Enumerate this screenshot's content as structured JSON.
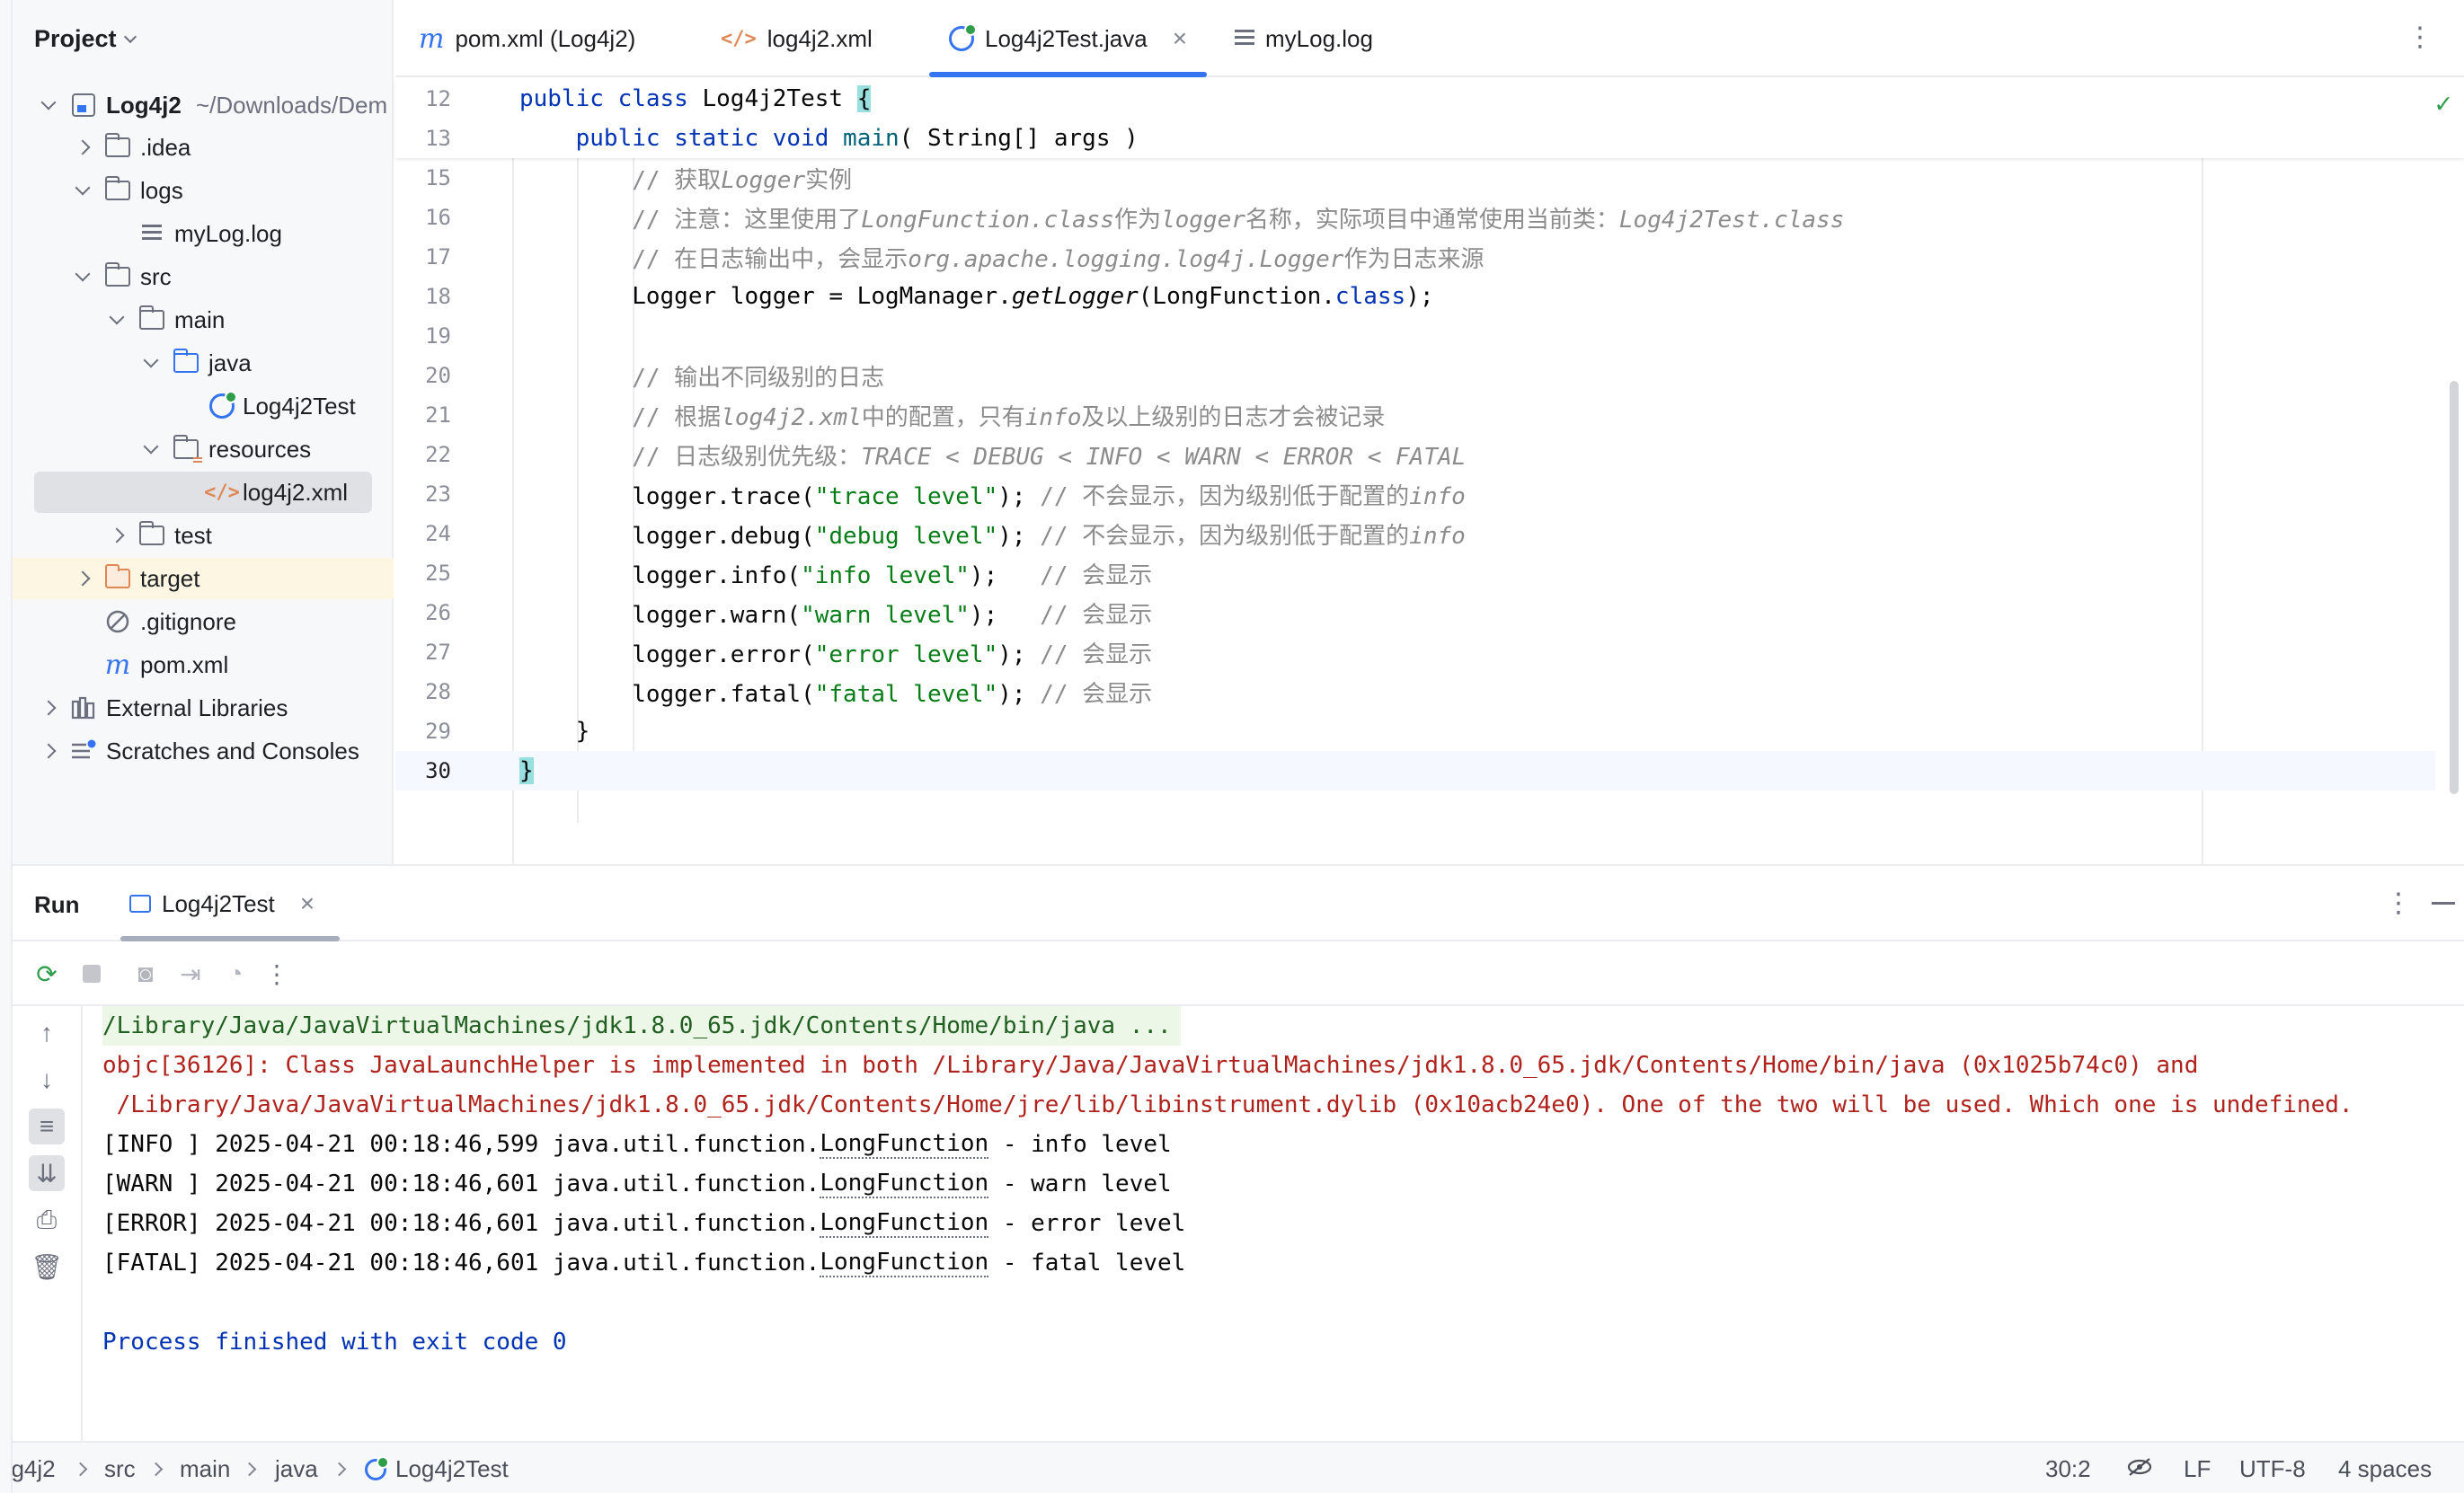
{
  "project_panel": {
    "title": "Project",
    "tree": [
      {
        "label": "Log4j2",
        "hint": "~/Downloads/Dem",
        "icon": "project-module-icon",
        "expanded": true
      },
      {
        "label": ".idea",
        "icon": "folder-icon"
      },
      {
        "label": "logs",
        "icon": "folder-icon",
        "expanded": true
      },
      {
        "label": "myLog.log",
        "icon": "log-file-icon"
      },
      {
        "label": "src",
        "icon": "folder-icon",
        "expanded": true
      },
      {
        "label": "main",
        "icon": "folder-icon",
        "expanded": true
      },
      {
        "label": "java",
        "icon": "source-folder-icon",
        "expanded": true
      },
      {
        "label": "Log4j2Test",
        "icon": "java-class-icon"
      },
      {
        "label": "resources",
        "icon": "resources-folder-icon",
        "expanded": true
      },
      {
        "label": "log4j2.xml",
        "icon": "xml-file-icon",
        "selected": true
      },
      {
        "label": "test",
        "icon": "folder-icon"
      },
      {
        "label": "target",
        "icon": "excluded-folder-icon"
      },
      {
        "label": ".gitignore",
        "icon": "ignored-file-icon"
      },
      {
        "label": "pom.xml",
        "icon": "maven-icon"
      },
      {
        "label": "External Libraries",
        "icon": "libraries-icon"
      },
      {
        "label": "Scratches and Consoles",
        "icon": "scratches-icon"
      }
    ]
  },
  "tabs": [
    {
      "label": "pom.xml (Log4j2)",
      "icon": "maven-icon"
    },
    {
      "label": "log4j2.xml",
      "icon": "xml-file-icon"
    },
    {
      "label": "Log4j2Test.java",
      "icon": "java-class-icon",
      "active": true
    },
    {
      "label": "myLog.log",
      "icon": "log-file-icon"
    }
  ],
  "editor": {
    "sticky_lines": [
      {
        "num": "12",
        "text": "public class Log4j2Test {"
      },
      {
        "num": "13",
        "text": "    public static void main( String[] args )"
      }
    ],
    "lines": [
      {
        "num": "15",
        "text": "        // 获取Logger实例"
      },
      {
        "num": "16",
        "text": "        // 注意：这里使用了LongFunction.class作为logger名称，实际项目中通常使用当前类：Log4j2Test.class"
      },
      {
        "num": "17",
        "text": "        // 在日志输出中，会显示org.apache.logging.log4j.Logger作为日志来源"
      },
      {
        "num": "18",
        "text": "        Logger logger = LogManager.getLogger(LongFunction.class);"
      },
      {
        "num": "19",
        "text": ""
      },
      {
        "num": "20",
        "text": "        // 输出不同级别的日志"
      },
      {
        "num": "21",
        "text": "        // 根据log4j2.xml中的配置，只有info及以上级别的日志才会被记录"
      },
      {
        "num": "22",
        "text": "        // 日志级别优先级：TRACE < DEBUG < INFO < WARN < ERROR < FATAL"
      },
      {
        "num": "23",
        "text": "        logger.trace(\"trace level\"); // 不会显示，因为级别低于配置的info"
      },
      {
        "num": "24",
        "text": "        logger.debug(\"debug level\"); // 不会显示，因为级别低于配置的info"
      },
      {
        "num": "25",
        "text": "        logger.info(\"info level\");   // 会显示"
      },
      {
        "num": "26",
        "text": "        logger.warn(\"warn level\");   // 会显示"
      },
      {
        "num": "27",
        "text": "        logger.error(\"error level\"); // 会显示"
      },
      {
        "num": "28",
        "text": "        logger.fatal(\"fatal level\"); // 会显示"
      },
      {
        "num": "29",
        "text": "    }"
      },
      {
        "num": "30",
        "text": "}"
      }
    ],
    "inspection_status": "no-problems-check-icon"
  },
  "run": {
    "title": "Run",
    "tab_label": "Log4j2Test",
    "console": [
      {
        "kind": "cmd",
        "text": "/Library/Java/JavaVirtualMachines/jdk1.8.0_65.jdk/Contents/Home/bin/java ..."
      },
      {
        "kind": "err",
        "text": "objc[36126]: Class JavaLaunchHelper is implemented in both /Library/Java/JavaVirtualMachines/jdk1.8.0_65.jdk/Contents/Home/bin/java (0x1025b74c0) and"
      },
      {
        "kind": "err",
        "text": " /Library/Java/JavaVirtualMachines/jdk1.8.0_65.jdk/Contents/Home/jre/lib/libinstrument.dylib (0x10acb24e0). One of the two will be used. Which one is undefined."
      },
      {
        "kind": "out",
        "prefix": "[INFO ] 2025-04-21 00:18:46,599 java.util.function.",
        "cls": "LongFunction",
        "suffix": " - info level"
      },
      {
        "kind": "out",
        "prefix": "[WARN ] 2025-04-21 00:18:46,601 java.util.function.",
        "cls": "LongFunction",
        "suffix": " - warn level"
      },
      {
        "kind": "out",
        "prefix": "[ERROR] 2025-04-21 00:18:46,601 java.util.function.",
        "cls": "LongFunction",
        "suffix": " - error level"
      },
      {
        "kind": "out",
        "prefix": "[FATAL] 2025-04-21 00:18:46,601 java.util.function.",
        "cls": "LongFunction",
        "suffix": " - fatal level"
      },
      {
        "kind": "blank",
        "text": ""
      },
      {
        "kind": "exit",
        "text": "Process finished with exit code 0"
      }
    ]
  },
  "status_bar": {
    "breadcrumbs": [
      "og4j2",
      "src",
      "main",
      "java",
      "Log4j2Test"
    ],
    "caret": "30:2",
    "line_separator": "LF",
    "encoding": "UTF-8",
    "indent": "4 spaces"
  },
  "colors": {
    "accent": "#3574f0",
    "keyword": "#0033b3",
    "string": "#067d17",
    "comment": "#8c8c8c",
    "error_text": "#b0231d",
    "selection": "#dfe1e5"
  }
}
